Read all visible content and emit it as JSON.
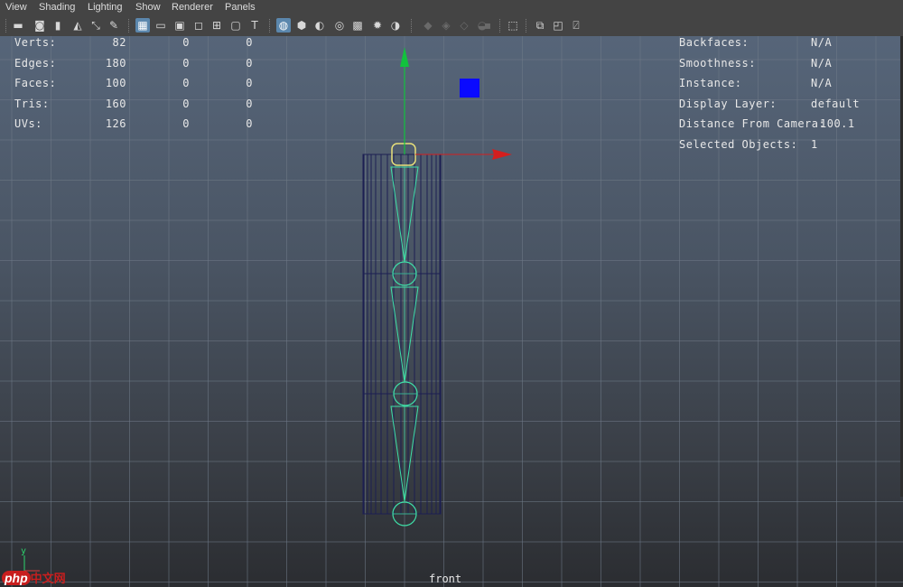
{
  "menu": [
    "View",
    "Shading",
    "Lighting",
    "Show",
    "Renderer",
    "Panels"
  ],
  "toolbar": {
    "icons": [
      {
        "name": "select-camera-icon",
        "glyph": "▬"
      },
      {
        "name": "camera-attributes-icon",
        "glyph": "◙"
      },
      {
        "name": "bookmarks-icon",
        "glyph": "▮"
      },
      {
        "name": "image-plane-icon",
        "glyph": "◭"
      },
      {
        "name": "two-d-pan-zoom-icon",
        "glyph": "⤡"
      },
      {
        "name": "grease-pencil-icon",
        "glyph": "✎"
      },
      {
        "name": "grid-icon",
        "glyph": "▦",
        "active": true
      },
      {
        "name": "film-gate-icon",
        "glyph": "▭"
      },
      {
        "name": "resolution-gate-icon",
        "glyph": "▣"
      },
      {
        "name": "gate-mask-icon",
        "glyph": "◻"
      },
      {
        "name": "field-chart-icon",
        "glyph": "⊞"
      },
      {
        "name": "safe-action-icon",
        "glyph": "▢"
      },
      {
        "name": "safe-title-icon",
        "glyph": "T"
      },
      {
        "name": "wireframe-icon",
        "glyph": "◍",
        "active": true
      },
      {
        "name": "smooth-shade-icon",
        "glyph": "⬢"
      },
      {
        "name": "default-material-icon",
        "glyph": "◐"
      },
      {
        "name": "wireframe-on-shaded-icon",
        "glyph": "◎"
      },
      {
        "name": "textured-icon",
        "glyph": "▩"
      },
      {
        "name": "all-lights-icon",
        "glyph": "✹"
      },
      {
        "name": "shadows-icon",
        "glyph": "◑"
      },
      {
        "name": "screen-space-ao-icon",
        "glyph": "◆",
        "dim": true
      },
      {
        "name": "motion-blur-icon",
        "glyph": "◈",
        "dim": true
      },
      {
        "name": "anti-aliasing-icon",
        "glyph": "◇",
        "dim": true
      },
      {
        "name": "depth-of-field-icon",
        "glyph": "◒",
        "dim": true
      },
      {
        "name": "isolate-select-icon",
        "glyph": "▪",
        "dim": true
      },
      {
        "name": "xray-icon",
        "glyph": "⬚"
      },
      {
        "name": "xray-joints-icon",
        "glyph": "⧉"
      },
      {
        "name": "xray-active-components-icon",
        "glyph": "◰"
      },
      {
        "name": "backface-culling-icon",
        "glyph": "⍁"
      }
    ]
  },
  "hud_left": {
    "rows": [
      {
        "label": "Verts:",
        "v1": "82",
        "v2": "0",
        "v3": "0"
      },
      {
        "label": "Edges:",
        "v1": "180",
        "v2": "0",
        "v3": "0"
      },
      {
        "label": "Faces:",
        "v1": "100",
        "v2": "0",
        "v3": "0"
      },
      {
        "label": "Tris:",
        "v1": "160",
        "v2": "0",
        "v3": "0"
      },
      {
        "label": "UVs:",
        "v1": "126",
        "v2": "0",
        "v3": "0"
      }
    ]
  },
  "hud_right": {
    "rows": [
      {
        "label": "Backfaces:",
        "value": "N/A"
      },
      {
        "label": "Smoothness:",
        "value": "N/A"
      },
      {
        "label": "Instance:",
        "value": "N/A"
      },
      {
        "label": "Display Layer:",
        "value": "default"
      },
      {
        "label": "Distance From Camera:",
        "value": "100.1"
      },
      {
        "label": "Selected Objects:",
        "value": "1"
      }
    ]
  },
  "camera_name": "front",
  "axis_label": "y",
  "watermark": {
    "php": "php",
    "cn": "中文网"
  },
  "colors": {
    "joint": "#3fe0a8",
    "selected": "#e8e07a",
    "mesh": "#1c1f52",
    "axis_y": "#12c23d",
    "axis_x": "#d41e1e",
    "locator": "#0a0aff",
    "grid": "#6f7a88"
  }
}
